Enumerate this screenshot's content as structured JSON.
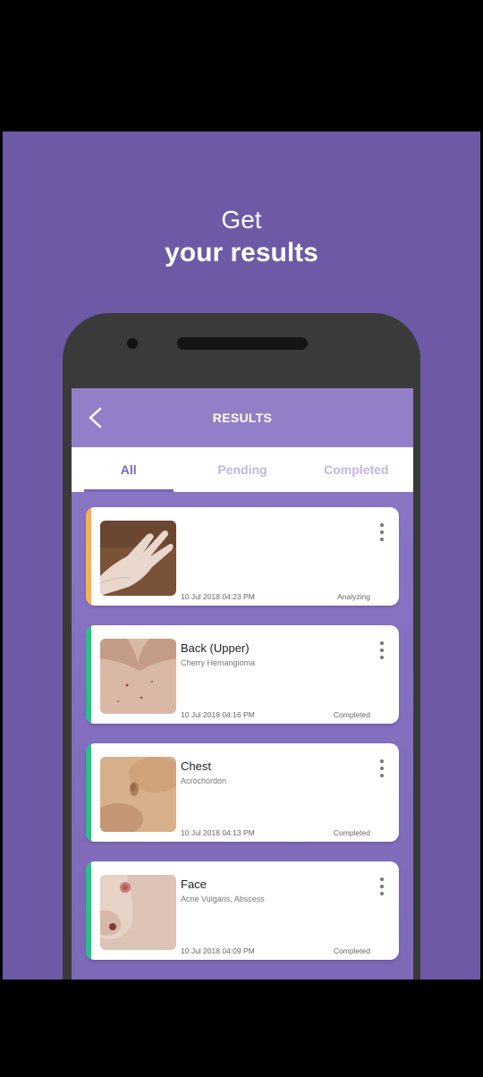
{
  "promo": {
    "line1": "Get",
    "line2": "your results"
  },
  "app": {
    "title": "RESULTS",
    "tabs": [
      {
        "label": "All",
        "active": true
      },
      {
        "label": "Pending",
        "active": false
      },
      {
        "label": "Completed",
        "active": false
      }
    ]
  },
  "results": [
    {
      "title": "",
      "subtitle": "",
      "datetime": "10 Jul 2018 04:23 PM",
      "status": "Analyzing",
      "status_color": "#f6b24b",
      "image": "hand"
    },
    {
      "title": "Back (Upper)",
      "subtitle": "Cherry Hemangioma",
      "datetime": "10 Jul 2018 04:16 PM",
      "status": "Completed",
      "status_color": "#23c287",
      "image": "back"
    },
    {
      "title": "Chest",
      "subtitle": "Acrochordon",
      "datetime": "10 Jul 2018 04:13 PM",
      "status": "Completed",
      "status_color": "#23c287",
      "image": "chest"
    },
    {
      "title": "Face",
      "subtitle": "Acne Vulgaris, Abscess",
      "datetime": "10 Jul 2018 04:09 PM",
      "status": "Completed",
      "status_color": "#23c287",
      "image": "face"
    }
  ],
  "icons": {
    "back": "chevron-left-icon",
    "more": "more-vertical-icon"
  },
  "colors": {
    "background": "#6e59a6",
    "accent": "#7a64b5",
    "analyzing": "#f6b24b",
    "completed": "#23c287"
  }
}
